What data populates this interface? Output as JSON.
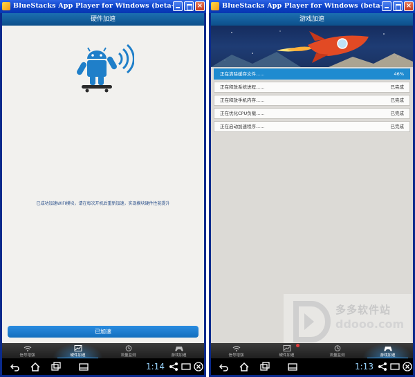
{
  "windows": [
    {
      "title": "BlueStacks App Player for Windows (beta-1)",
      "header": "硬件加速",
      "message": "已成功加速WIFI模块，请在每次开机后重新加速，实现模块硬件性能提升",
      "button_label": "已加速",
      "tabs": [
        {
          "label": "信号增强",
          "icon": "wifi-icon"
        },
        {
          "label": "硬件加速",
          "icon": "chart-icon",
          "active": true
        },
        {
          "label": "流量监测",
          "icon": "clock-icon"
        },
        {
          "label": "游戏加速",
          "icon": "gamepad-icon"
        }
      ],
      "clock": "1:14"
    },
    {
      "title": "BlueStacks App Player for Windows (beta-1)",
      "header": "游戏加速",
      "tasks": [
        {
          "label": "正在清除缓存文件......",
          "status": "46%",
          "active": true
        },
        {
          "label": "正在释放系统进程......",
          "status": "已完成"
        },
        {
          "label": "正在释放手机内存......",
          "status": "已完成"
        },
        {
          "label": "正在优化CPU负载......",
          "status": "已完成"
        },
        {
          "label": "正在启动加速程序......",
          "status": "已完成"
        }
      ],
      "watermark": {
        "name": "多多软件站",
        "url": "ddooo.com"
      },
      "tabs": [
        {
          "label": "信号增强",
          "icon": "wifi-icon"
        },
        {
          "label": "硬件加速",
          "icon": "chart-icon"
        },
        {
          "label": "流量监测",
          "icon": "clock-icon"
        },
        {
          "label": "游戏加速",
          "icon": "gamepad-icon",
          "active": true
        }
      ],
      "clock": "1:13"
    }
  ],
  "colors": {
    "titlebar": "#0a3fc4",
    "app_header": "#1b6fb1",
    "accent": "#1f8bd0",
    "content_bg": "#f2f1ee",
    "clock": "#9ad6ff"
  }
}
